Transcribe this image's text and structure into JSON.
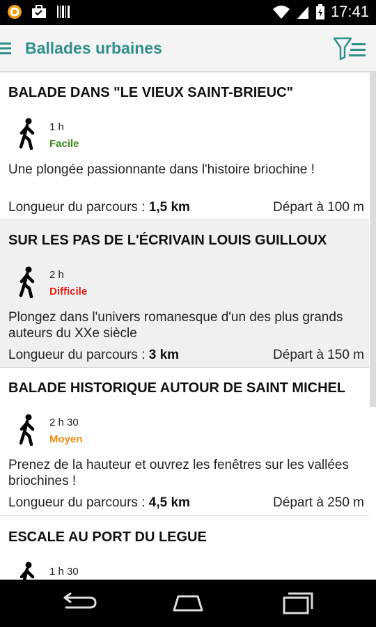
{
  "status_bar": {
    "time": "17:41"
  },
  "app_bar": {
    "title": "Ballades urbaines"
  },
  "colors": {
    "accent": "#2f8f8a",
    "facile": "#3c8a1e",
    "difficile": "#e5211b",
    "moyen": "#f08a12"
  },
  "walks": [
    {
      "title": "BALADE DANS \"LE VIEUX SAINT-BRIEUC\"",
      "duration": "1 h",
      "level": "Facile",
      "level_color": "#3c8a1e",
      "description": "Une plongée passionnante dans l'histoire briochine !",
      "length_label": "Longueur du parcours : ",
      "length_value": "1,5 km",
      "departure": "Départ à 100 m"
    },
    {
      "title": "SUR LES PAS DE L'ÉCRIVAIN LOUIS GUILLOUX",
      "duration": "2 h",
      "level": "Difficile",
      "level_color": "#e5211b",
      "description": "Plongez dans l'univers romanesque d'un des plus grands auteurs du XXe siècle",
      "length_label": "Longueur du parcours : ",
      "length_value": "3 km",
      "departure": "Départ à 150 m"
    },
    {
      "title": "BALADE HISTORIQUE AUTOUR DE SAINT MICHEL",
      "duration": "2 h 30",
      "level": "Moyen",
      "level_color": "#f08a12",
      "description": "Prenez de la hauteur et ouvrez les fenêtres sur les vallées briochines !",
      "length_label": "Longueur du parcours : ",
      "length_value": "4,5 km",
      "departure": "Départ à 250 m"
    },
    {
      "title": "ESCALE AU PORT DU LEGUE",
      "duration": "1 h 30"
    }
  ]
}
